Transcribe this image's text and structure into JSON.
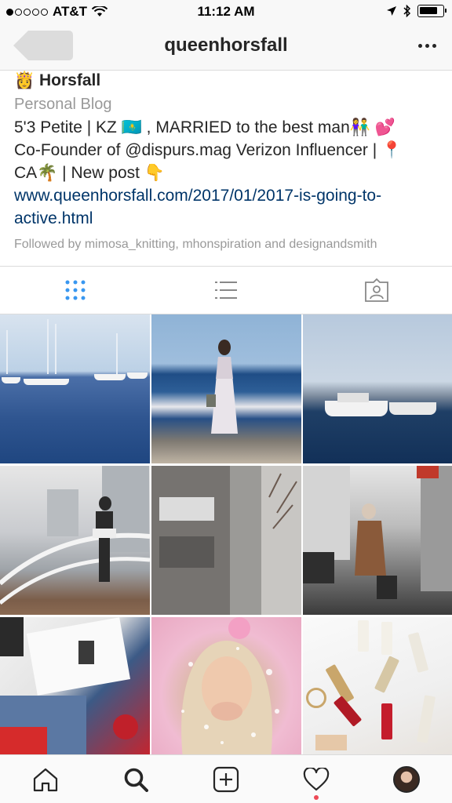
{
  "status_bar": {
    "carrier": "AT&T",
    "time": "11:12 AM",
    "signal_bars_filled": 1,
    "signal_bars_total": 5
  },
  "nav": {
    "title": "queenhorsfall",
    "back_icon": "back-arrow-icon",
    "more_icon": "more-dots-icon"
  },
  "bio": {
    "name": "👸 Horsfall",
    "category": "Personal Blog",
    "line1": "5'3 Petite | KZ 🇰🇿 , MARRIED to the best man👫 💕",
    "line2": "Co-Founder of @dispurs.mag Verizon Influencer | 📍",
    "line3": "CA🌴  | New post 👇",
    "link_line1": "www.queenhorsfall.com/2017/01/2017-is-going-to-",
    "link_line2": "active.html",
    "followed_by": "Followed by mimosa_knitting, mhonspiration and designandsmith"
  },
  "profile_tabs": [
    {
      "icon": "grid-view-icon",
      "active": true
    },
    {
      "icon": "list-view-icon",
      "active": false
    },
    {
      "icon": "tagged-photos-icon",
      "active": false
    }
  ],
  "colors": {
    "accent": "#3897f0",
    "link": "#003569",
    "muted": "#999999",
    "text": "#262626",
    "notification": "#ed4956"
  },
  "posts": [
    {
      "subject": "marina sailboats"
    },
    {
      "subject": "woman on beach"
    },
    {
      "subject": "harbor yachts"
    },
    {
      "subject": "woman on balcony"
    },
    {
      "subject": "street with houses"
    },
    {
      "subject": "woman in city street"
    },
    {
      "subject": "magazines and rose"
    },
    {
      "subject": "woman blowing glitter"
    },
    {
      "subject": "lipsticks flat lay"
    }
  ],
  "bottom_tabs": [
    {
      "icon": "home-icon"
    },
    {
      "icon": "search-icon",
      "active": true
    },
    {
      "icon": "add-post-icon"
    },
    {
      "icon": "activity-heart-icon",
      "has_notification": true
    },
    {
      "icon": "profile-avatar-icon"
    }
  ]
}
